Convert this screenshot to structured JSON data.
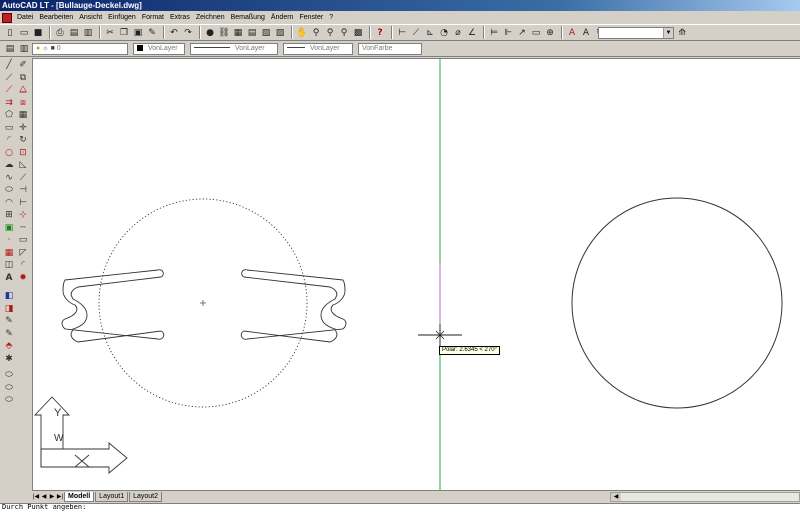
{
  "window": {
    "title": "AutoCAD LT - [Bullauge-Deckel.dwg]"
  },
  "menu": {
    "items": [
      "Datei",
      "Bearbeiten",
      "Ansicht",
      "Einfügen",
      "Format",
      "Extras",
      "Zeichnen",
      "Bemaßung",
      "Ändern",
      "Fenster",
      "?"
    ]
  },
  "properties_bar": {
    "layer": "0",
    "color": "VonLayer",
    "linetype": "VonLayer",
    "lineweight": "VonLayer",
    "plotstyle": "VonFarbe"
  },
  "canvas": {
    "tooltip": "Polar: 2.6345 < 270°",
    "ucs_icon": {
      "y_label": "Y",
      "w_label": "W"
    }
  },
  "tabs": {
    "model": "Modell",
    "layout1": "Layout1",
    "layout2": "Layout2"
  },
  "command_line": {
    "line1": "Durch Punkt angeben:"
  }
}
